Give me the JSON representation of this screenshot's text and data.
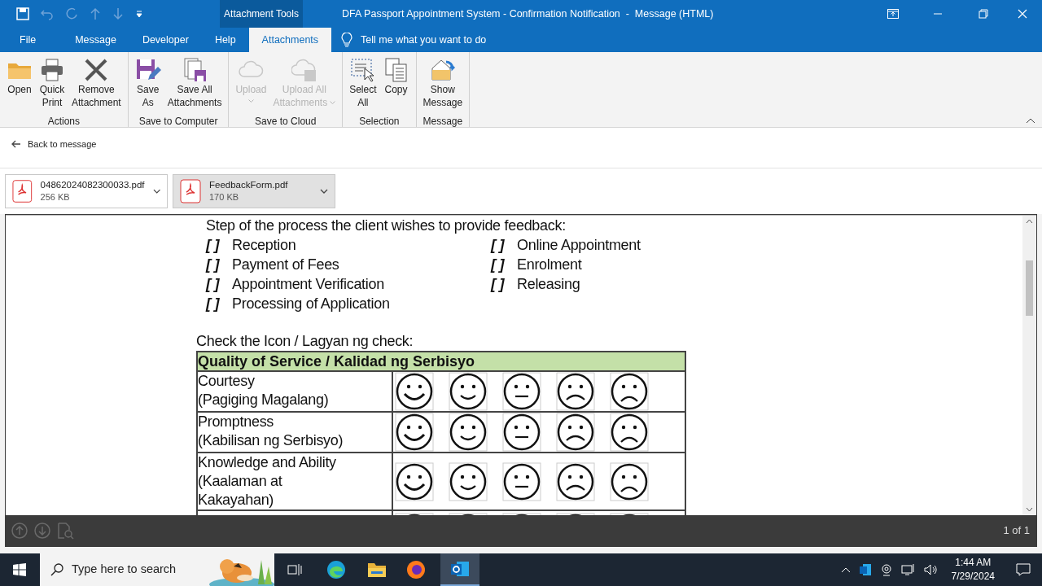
{
  "window": {
    "title": "DFA Passport Appointment System - Confirmation Notification  -  Message (HTML)",
    "context_group": "Attachment Tools"
  },
  "menu_tabs": [
    {
      "label": "File",
      "selected": false
    },
    {
      "label": "Message",
      "selected": false
    },
    {
      "label": "Developer",
      "selected": false
    },
    {
      "label": "Help",
      "selected": false
    },
    {
      "label": "Attachments",
      "selected": true
    }
  ],
  "tell_me": {
    "placeholder": "Tell me what you want to do"
  },
  "ribbon_groups": [
    {
      "label": "Actions",
      "buttons": [
        {
          "kind": "open",
          "lines": [
            "Open"
          ],
          "disabled": false,
          "dropdown": false
        },
        {
          "kind": "print",
          "lines": [
            "Quick",
            "Print"
          ],
          "disabled": false,
          "dropdown": false
        },
        {
          "kind": "remove",
          "lines": [
            "Remove",
            "Attachment"
          ],
          "disabled": false,
          "dropdown": false
        }
      ]
    },
    {
      "label": "Save to Computer",
      "buttons": [
        {
          "kind": "save",
          "lines": [
            "Save",
            "As"
          ],
          "disabled": false,
          "dropdown": false
        },
        {
          "kind": "saveall",
          "lines": [
            "Save All",
            "Attachments"
          ],
          "disabled": false,
          "dropdown": false
        }
      ]
    },
    {
      "label": "Save to Cloud",
      "buttons": [
        {
          "kind": "upload",
          "lines": [
            "Upload"
          ],
          "disabled": true,
          "dropdown": true
        },
        {
          "kind": "uploadall",
          "lines": [
            "Upload All",
            "Attachments"
          ],
          "disabled": true,
          "dropdown": true
        }
      ]
    },
    {
      "label": "Selection",
      "buttons": [
        {
          "kind": "select",
          "lines": [
            "Select",
            "All"
          ],
          "disabled": false,
          "dropdown": false
        },
        {
          "kind": "copy",
          "lines": [
            "Copy"
          ],
          "disabled": false,
          "dropdown": false
        }
      ]
    },
    {
      "label": "Message",
      "buttons": [
        {
          "kind": "message",
          "lines": [
            "Show",
            "Message"
          ],
          "disabled": false,
          "dropdown": false
        }
      ]
    }
  ],
  "back_link": "Back to message",
  "attachments": [
    {
      "name": "04862024082300033.pdf",
      "size": "256 KB",
      "selected": false
    },
    {
      "name": "FeedbackForm.pdf",
      "size": "170 KB",
      "selected": true
    }
  ],
  "document": {
    "step_prompt": "Step of the process the client wishes to provide feedback:",
    "steps_left": [
      {
        "box": "[ ]",
        "label": "Reception"
      },
      {
        "box": "[ ]",
        "label": "Payment of Fees"
      },
      {
        "box": "[ ]",
        "label": "Appointment Verification"
      },
      {
        "box": "[ ]",
        "label": "Processing of Application"
      }
    ],
    "steps_right": [
      {
        "box": "[ ]",
        "label": "Online Appointment"
      },
      {
        "box": "[ ]",
        "label": "Enrolment"
      },
      {
        "box": "[ ]",
        "label": "Releasing"
      }
    ],
    "check_prompt": "Check the Icon / Lagyan ng check:",
    "table_header": "Quality of Service / Kalidad ng Serbisyo",
    "rows": [
      {
        "lines": [
          "Courtesy",
          "(Pagiging Magalang)"
        ]
      },
      {
        "lines": [
          "Promptness",
          "(Kabilisan ng Serbisyo)"
        ]
      },
      {
        "lines": [
          "Knowledge and Ability",
          "(Kaalaman at",
          "Kakayahan)"
        ]
      }
    ]
  },
  "viewer": {
    "page_count": "1 of 1"
  },
  "taskbar": {
    "search_placeholder": "Type here to search",
    "time": "1:44 AM",
    "date": "7/29/2024"
  }
}
